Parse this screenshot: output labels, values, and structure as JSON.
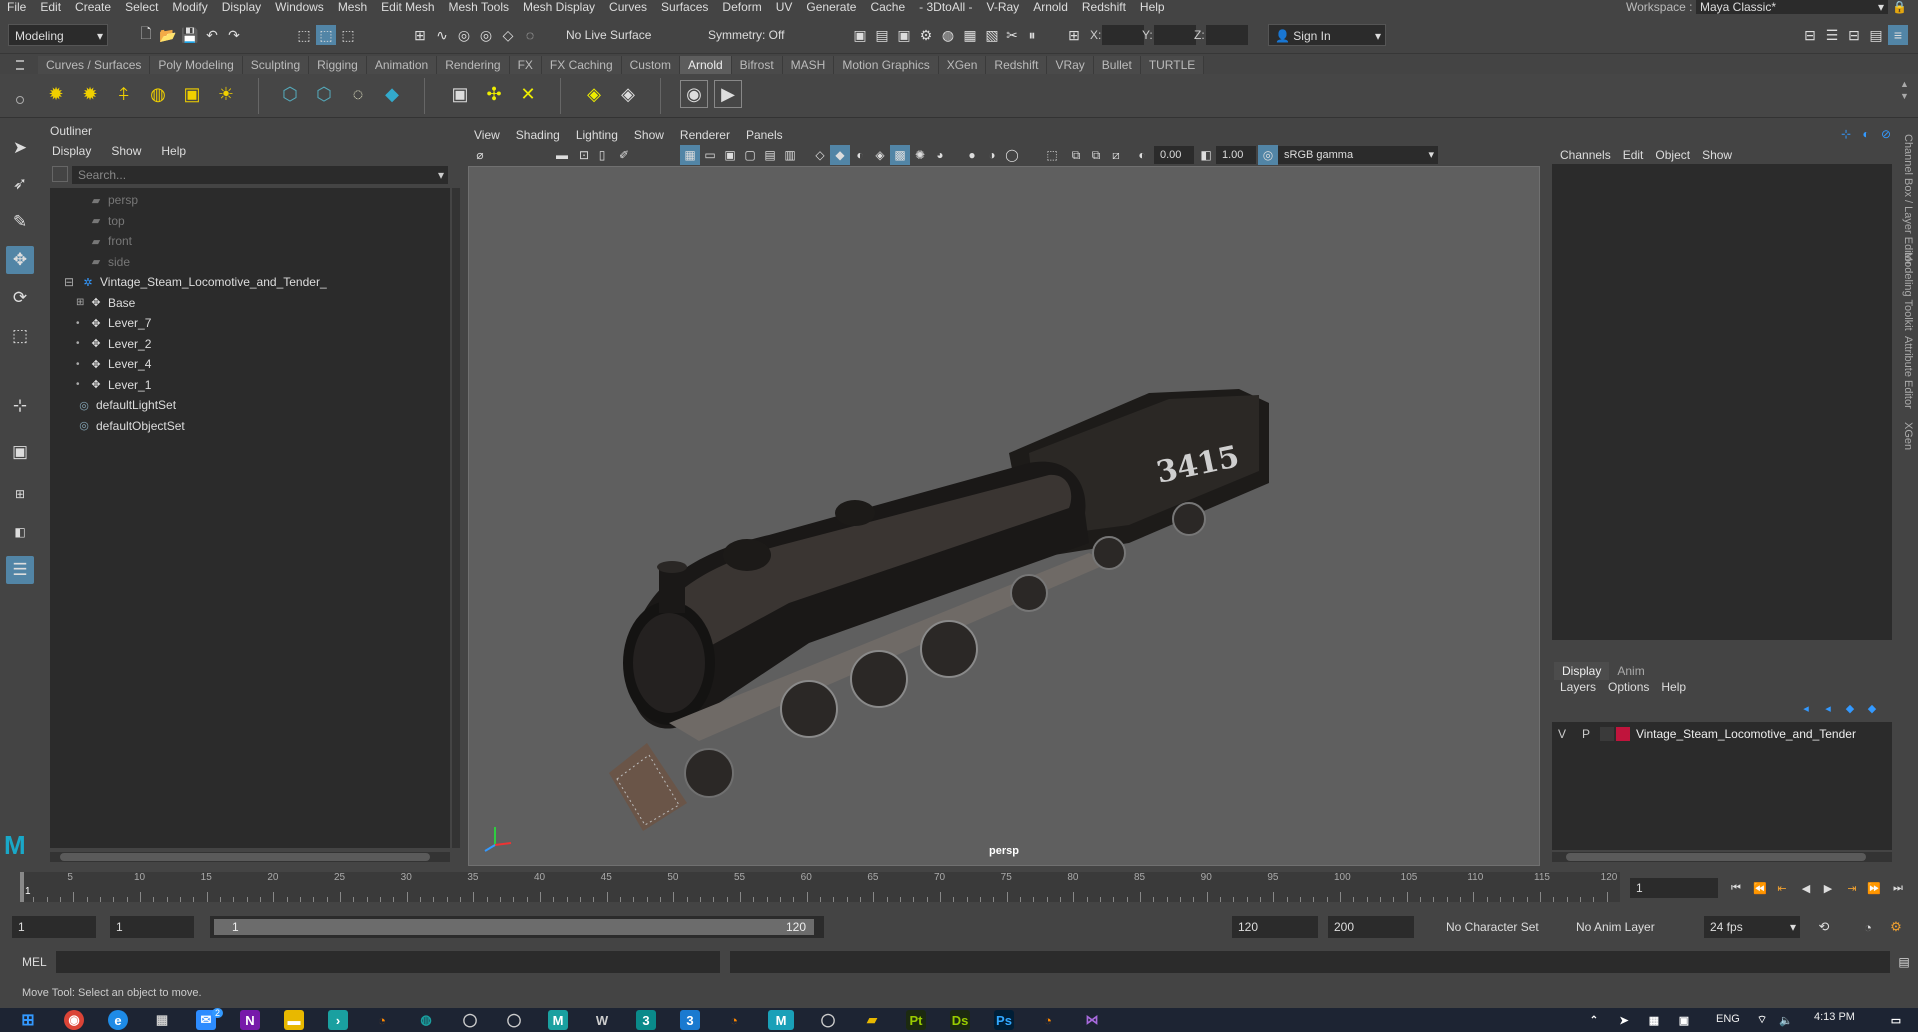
{
  "menubar": {
    "items": [
      "File",
      "Edit",
      "Create",
      "Select",
      "Modify",
      "Display",
      "Windows",
      "Mesh",
      "Edit Mesh",
      "Mesh Tools",
      "Mesh Display",
      "Curves",
      "Surfaces",
      "Deform",
      "UV",
      "Generate",
      "Cache",
      "- 3DtoAll -",
      "V-Ray",
      "Arnold",
      "Redshift",
      "Help"
    ],
    "workspace_label": "Workspace :",
    "workspace_value": "Maya Classic*"
  },
  "status_line": {
    "mode": "Modeling",
    "live_surface": "No Live Surface",
    "symmetry": "Symmetry: Off",
    "x_label": "X:",
    "y_label": "Y:",
    "z_label": "Z:",
    "sign_in": "Sign In"
  },
  "shelf": {
    "tabs": [
      "Curves / Surfaces",
      "Poly Modeling",
      "Sculpting",
      "Rigging",
      "Animation",
      "Rendering",
      "FX",
      "FX Caching",
      "Custom",
      "Arnold",
      "Bifrost",
      "MASH",
      "Motion Graphics",
      "XGen",
      "Redshift",
      "VRay",
      "Bullet",
      "TURTLE"
    ],
    "active_tab": "Arnold"
  },
  "outliner": {
    "title": "Outliner",
    "menu": [
      "Display",
      "Show",
      "Help"
    ],
    "search_placeholder": "Search...",
    "nodes": [
      {
        "label": "persp",
        "icon": "camera-icon",
        "dim": true
      },
      {
        "label": "top",
        "icon": "camera-icon",
        "dim": true
      },
      {
        "label": "front",
        "icon": "camera-icon",
        "dim": true
      },
      {
        "label": "side",
        "icon": "camera-icon",
        "dim": true
      },
      {
        "label": "Vintage_Steam_Locomotive_and_Tender_",
        "icon": "group-icon",
        "dim": false
      },
      {
        "label": "Base",
        "icon": "transform-icon",
        "dim": false
      },
      {
        "label": "Lever_7",
        "icon": "transform-icon",
        "dim": false
      },
      {
        "label": "Lever_2",
        "icon": "transform-icon",
        "dim": false
      },
      {
        "label": "Lever_4",
        "icon": "transform-icon",
        "dim": false
      },
      {
        "label": "Lever_1",
        "icon": "transform-icon",
        "dim": false
      },
      {
        "label": "defaultLightSet",
        "icon": "set-icon",
        "dim": false
      },
      {
        "label": "defaultObjectSet",
        "icon": "set-icon",
        "dim": false
      }
    ]
  },
  "viewport": {
    "menu": [
      "View",
      "Shading",
      "Lighting",
      "Show",
      "Renderer",
      "Panels"
    ],
    "exposure": "0.00",
    "gamma": "1.00",
    "color_space": "sRGB gamma",
    "camera": "persp",
    "tender_number": "3415"
  },
  "channel_box": {
    "menu": [
      "Channels",
      "Edit",
      "Object",
      "Show"
    ]
  },
  "layer_editor": {
    "tabs": [
      "Display",
      "Anim"
    ],
    "active_tab": "Display",
    "menu": [
      "Layers",
      "Options",
      "Help"
    ],
    "layers": [
      {
        "v": "V",
        "p": "P",
        "color": "#c0143c",
        "name": "Vintage_Steam_Locomotive_and_Tender"
      }
    ]
  },
  "side_tabs": [
    "Channel Box / Layer Editor",
    "Modeling Toolkit",
    "Attribute Editor",
    "XGen"
  ],
  "time_slider": {
    "ticks": [
      "5",
      "10",
      "15",
      "20",
      "25",
      "30",
      "35",
      "40",
      "45",
      "50",
      "55",
      "60",
      "65",
      "70",
      "75",
      "80",
      "85",
      "90",
      "95",
      "100",
      "105",
      "110",
      "115",
      "120"
    ],
    "current_frame_marker": "1",
    "current_frame": "1"
  },
  "range_slider": {
    "start": "1",
    "anim_start": "1",
    "range_start": "1",
    "range_end": "120",
    "end": "120",
    "anim_end": "200",
    "character_set": "No Character Set",
    "anim_layer": "No Anim Layer",
    "fps": "24 fps"
  },
  "command_line": {
    "label": "MEL"
  },
  "help_line": {
    "text": "Move Tool: Select an object to move."
  },
  "taskbar": {
    "time": "4:13 PM",
    "language": "ENG",
    "badge": "2"
  }
}
